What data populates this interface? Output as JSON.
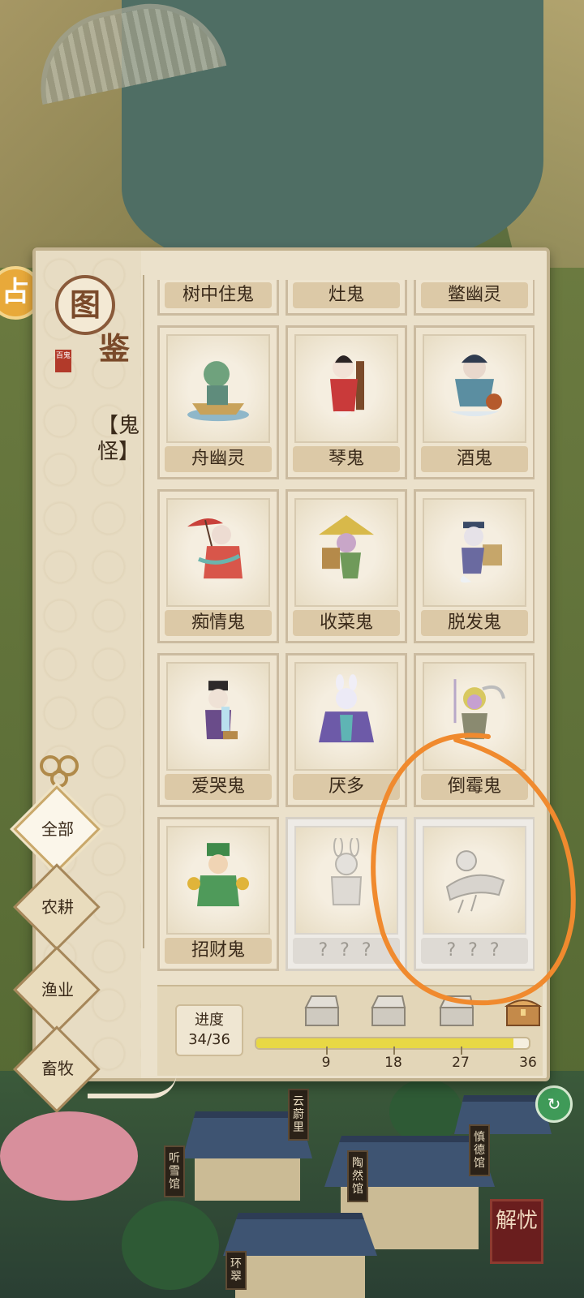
{
  "codex": {
    "title_char_1": "图",
    "title_char_2": "鉴",
    "title_stamp": "百鬼",
    "category": "【鬼怪】",
    "partial_row": [
      {
        "label": "树中住鬼"
      },
      {
        "label": "灶鬼"
      },
      {
        "label": "鳖幽灵"
      }
    ],
    "entries": [
      {
        "label": "舟幽灵",
        "locked": false
      },
      {
        "label": "琴鬼",
        "locked": false
      },
      {
        "label": "酒鬼",
        "locked": false
      },
      {
        "label": "痴情鬼",
        "locked": false
      },
      {
        "label": "收菜鬼",
        "locked": false
      },
      {
        "label": "脱发鬼",
        "locked": false
      },
      {
        "label": "爱哭鬼",
        "locked": false
      },
      {
        "label": "厌多",
        "locked": false
      },
      {
        "label": "倒霉鬼",
        "locked": false
      },
      {
        "label": "招财鬼",
        "locked": false
      },
      {
        "label": "? ? ?",
        "locked": true
      },
      {
        "label": "? ? ?",
        "locked": true
      }
    ],
    "progress": {
      "label": "进度",
      "value_text": "34/36",
      "current": 34,
      "total": 36,
      "milestones": [
        "9",
        "18",
        "27",
        "36"
      ]
    },
    "filters": [
      {
        "label": "全部",
        "active": true
      },
      {
        "label": "农耕",
        "active": false
      },
      {
        "label": "渔业",
        "active": false
      },
      {
        "label": "畜牧",
        "active": false
      }
    ]
  },
  "world": {
    "signs": [
      "云蔚里",
      "听雪馆",
      "陶然馆",
      "慎德馆",
      "环翠"
    ],
    "seal_button": "解忧",
    "coin_glyph": "占"
  },
  "colors": {
    "panel_bg": "#ebe1cb",
    "accent_brown": "#7a4a2a",
    "progress_fill": "#e8d844",
    "highlight": "#f08a2e"
  }
}
